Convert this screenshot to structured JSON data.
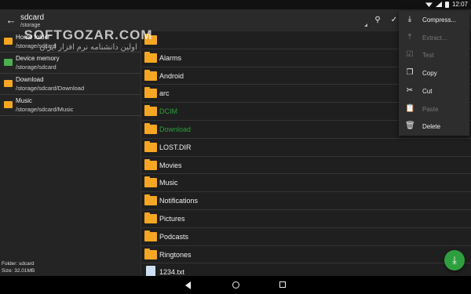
{
  "status_bar": {
    "time": "12:07"
  },
  "toolbar": {
    "title": "sdcard",
    "subtitle": "/storage"
  },
  "bookmarks": [
    {
      "name": "Home folder",
      "path": "/storage/sdcard",
      "icon": "home-folder-icon",
      "color": "#f5a623"
    },
    {
      "name": "Device memory",
      "path": "/storage/sdcard",
      "icon": "device-memory-icon",
      "color": "#4caf50"
    },
    {
      "name": "Download",
      "path": "/storage/sdcard/Download",
      "icon": "download-folder-icon",
      "color": "#f5a623"
    },
    {
      "name": "Music",
      "path": "/storage/sdcard/Music",
      "icon": "music-folder-icon",
      "color": "#f5a623"
    }
  ],
  "footer": {
    "folder": "Folder: sdcard",
    "size": "Size: 32.01MB"
  },
  "files": [
    {
      "name": "",
      "type": "folder-home",
      "color": "#efefef"
    },
    {
      "name": "Alarms",
      "type": "folder",
      "color": "#efefef"
    },
    {
      "name": "Android",
      "type": "folder",
      "color": "#efefef"
    },
    {
      "name": "arc",
      "type": "folder",
      "color": "#efefef"
    },
    {
      "name": "DCIM",
      "type": "folder",
      "color": "#2e9f3e"
    },
    {
      "name": "Download",
      "type": "folder",
      "color": "#2e9f3e"
    },
    {
      "name": "LOST.DIR",
      "type": "folder",
      "color": "#efefef"
    },
    {
      "name": "Movies",
      "type": "folder",
      "color": "#efefef"
    },
    {
      "name": "Music",
      "type": "folder",
      "color": "#efefef"
    },
    {
      "name": "Notifications",
      "type": "folder",
      "color": "#efefef"
    },
    {
      "name": "Pictures",
      "type": "folder",
      "color": "#efefef"
    },
    {
      "name": "Podcasts",
      "type": "folder",
      "color": "#efefef"
    },
    {
      "name": "Ringtones",
      "type": "folder",
      "color": "#efefef"
    },
    {
      "name": "1234.txt",
      "type": "file",
      "color": "#efefef"
    }
  ],
  "context_menu": [
    {
      "label": "Compress...",
      "icon": "download-icon",
      "glyph": "⤓",
      "enabled": true
    },
    {
      "label": "Extract...",
      "icon": "upload-icon",
      "glyph": "⤒",
      "enabled": false
    },
    {
      "label": "Test",
      "icon": "checkbox-icon",
      "glyph": "☑",
      "enabled": false
    },
    {
      "label": "Copy",
      "icon": "copy-icon",
      "glyph": "❐",
      "enabled": true
    },
    {
      "label": "Cut",
      "icon": "scissors-icon",
      "glyph": "✂",
      "enabled": true
    },
    {
      "label": "Paste",
      "icon": "clipboard-icon",
      "glyph": "📋",
      "enabled": false
    },
    {
      "label": "Delete",
      "icon": "trash-icon",
      "glyph": "🗑",
      "enabled": true
    }
  ],
  "watermark": {
    "line1": "SOFTGOZAR.COM",
    "line2": "اولین دانشنامه نرم افزار ایران"
  },
  "colors": {
    "accent_green": "#2e9f3e",
    "folder_orange": "#f5a623"
  }
}
